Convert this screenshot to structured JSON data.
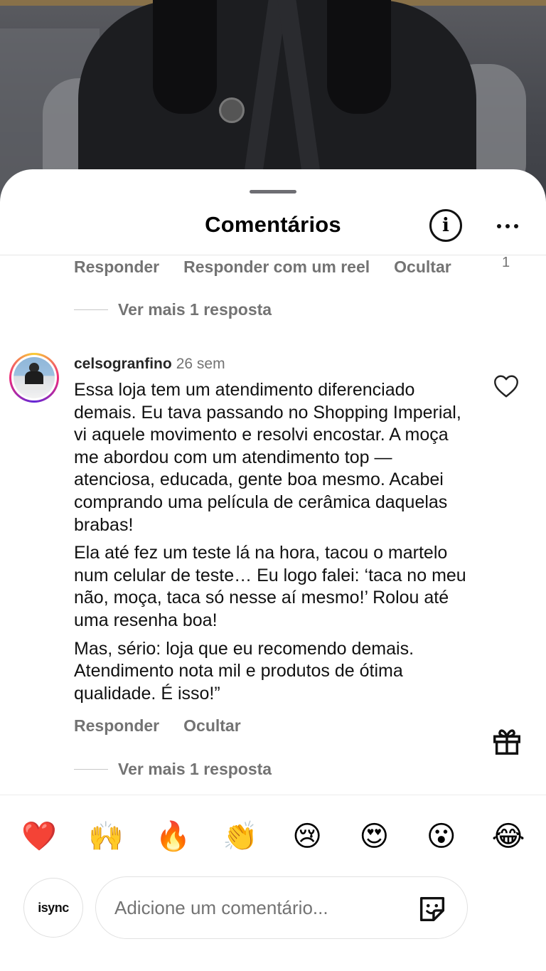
{
  "sheet": {
    "title": "Comentários"
  },
  "prev_comment": {
    "actions": [
      "Responder",
      "Responder com um reel",
      "Ocultar"
    ],
    "like_count": "1",
    "more_replies": "Ver mais 1 resposta"
  },
  "comment": {
    "username": "celsogranfino",
    "time": "26 sem",
    "paragraphs": [
      "Essa loja tem um atendimento diferenciado demais. Eu tava passando no Shopping Imperial, vi aquele movimento e resolvi encostar. A moça me abordou com um atendimento top — atenciosa, educada, gente boa mesmo. Acabei comprando uma película de cerâmica daquelas brabas!",
      "Ela até fez um teste lá na hora, tacou o martelo num celular de teste… Eu logo falei: ‘taca no meu não, moça, taca só nesse aí mesmo!’ Rolou até uma resenha boa!",
      "Mas, sério: loja que eu recomendo demais. Atendimento nota mil e produtos de ótima qualidade. É isso!”"
    ],
    "actions": [
      "Responder",
      "Ocultar"
    ],
    "more_replies": "Ver mais 1 resposta"
  },
  "emoji_reactions": [
    "❤️",
    "🙌",
    "🔥",
    "👏",
    "😢",
    "😍",
    "😮",
    "😂"
  ],
  "composer": {
    "avatar_text": "isync",
    "placeholder": "Adicione um comentário..."
  },
  "icons": {
    "info": "info-icon",
    "more": "more-horizontal-icon",
    "heart": "heart-outline-icon",
    "sticker": "sticker-icon",
    "gift": "gift-icon"
  }
}
